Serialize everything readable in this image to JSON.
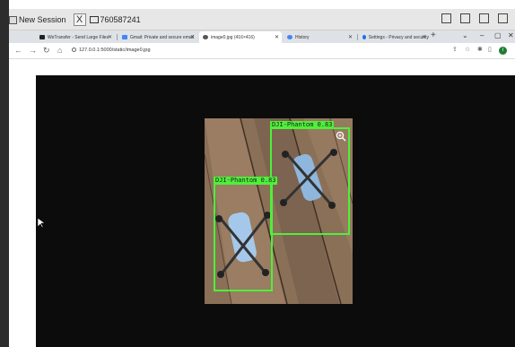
{
  "session": {
    "label": "New Session",
    "close_glyph": "X",
    "session_id": "760587241"
  },
  "tabs": [
    {
      "title": "WeTransfer - Send Large Files",
      "fav_color": "#222222"
    },
    {
      "title": "Gmail: Private and secure email",
      "fav_color": "#4285f4"
    },
    {
      "title": "image0.jpg (416×416)",
      "fav_color": "#555555"
    },
    {
      "title": "History",
      "fav_color": "#4285f4"
    },
    {
      "title": "Settings - Privacy and security",
      "fav_color": "#1a73e8"
    }
  ],
  "address": {
    "url": "127.0.0.1:5000/static/image0.jpg"
  },
  "detections": [
    {
      "label": "DJI-Phantom 0.83"
    },
    {
      "label": "DJI-Phantom 0.83"
    }
  ],
  "colors": {
    "bbox": "#4ef03a",
    "background": "#0c0c0c"
  }
}
